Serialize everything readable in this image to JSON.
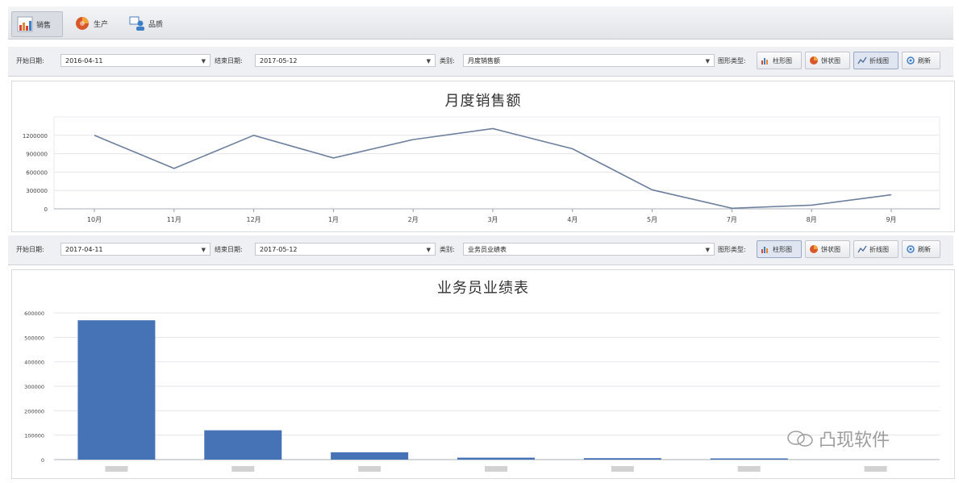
{
  "tabs": [
    {
      "label": "销售",
      "icon": "sales-chart-icon",
      "active": true
    },
    {
      "label": "生产",
      "icon": "production-globe-icon",
      "active": false
    },
    {
      "label": "品质",
      "icon": "quality-person-icon",
      "active": false
    }
  ],
  "toolbar_labels": {
    "start_date": "开始日期:",
    "end_date": "结束日期:",
    "category": "类别:",
    "chart_type": "图形类型:"
  },
  "chart_buttons": {
    "bar": "柱形图",
    "pie": "饼状图",
    "line": "折线图",
    "refresh": "刷新"
  },
  "filter1": {
    "start_date": "2016-04-11",
    "end_date": "2017-05-12",
    "category": "月度销售额",
    "active_type": "line"
  },
  "filter2": {
    "start_date": "2017-04-11",
    "end_date": "2017-05-12",
    "category": "业务员业绩表",
    "active_type": "bar"
  },
  "watermark": "凸现软件",
  "colors": {
    "line": "#6d7f9c",
    "bar": "#4573b6",
    "grid": "#e3e6ea",
    "toolbar_bg": "#eef0f3"
  },
  "chart_data": [
    {
      "type": "line",
      "title": "月度销售额",
      "categories": [
        "10月",
        "11月",
        "12月",
        "1月",
        "2月",
        "3月",
        "4月",
        "5月",
        "7月",
        "8月",
        "9月"
      ],
      "values": [
        1200000,
        660000,
        1200000,
        830000,
        1130000,
        1310000,
        980000,
        310000,
        10000,
        60000,
        230000
      ],
      "yticks": [
        "1200000",
        "900000",
        "600000",
        "300000",
        "0"
      ],
      "ylim": [
        0,
        1500000
      ],
      "grid": true
    },
    {
      "type": "bar",
      "title": "业务员业绩表",
      "categories": [
        "",
        "",
        "",
        "",
        "",
        "",
        ""
      ],
      "values": [
        570000,
        120000,
        30000,
        8000,
        6000,
        5000,
        0
      ],
      "yticks": [
        "600000",
        "500000",
        "400000",
        "300000",
        "200000",
        "100000",
        "0"
      ],
      "ylim": [
        0,
        630000
      ],
      "grid": true
    }
  ]
}
